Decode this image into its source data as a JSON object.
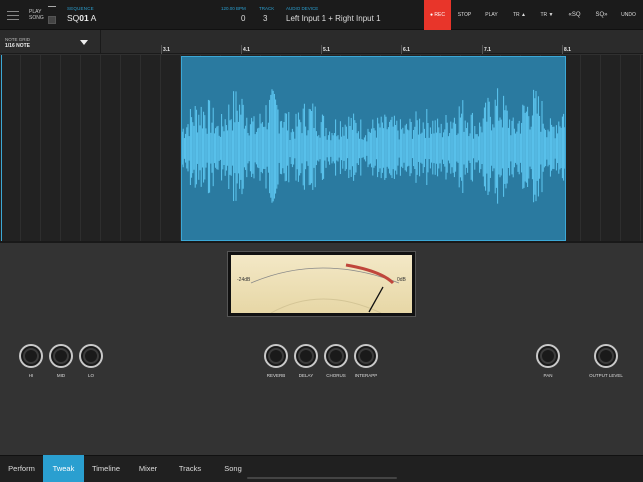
{
  "header": {
    "play_song": "PLAY\nSONG",
    "sequence_label": "SEQUENCE",
    "sequence_prefix": "SQ",
    "sequence_number": "01",
    "sequence_suffix": " A",
    "bpm_label": "120.00 BPM",
    "bpm_value": "0",
    "track_label": "TRACK",
    "track_value": "3",
    "audio_device_label": "AUDIO DEVICE",
    "audio_device_value": "Left Input 1 + Right Input 1",
    "rec_label": "● REC",
    "stop_label": "STOP",
    "play_label": "PLAY",
    "tr_up": "TR ▲",
    "tr_down": "TR ▼",
    "sq_prev": "«SQ",
    "sq_next": "SQ»",
    "undo": "UNDO",
    "rec_color": "#e8352a"
  },
  "note_grid": {
    "label": "NOTE GRID",
    "value": "1/16 NOTE"
  },
  "ruler": [
    "3.1",
    "4.1",
    "5.1",
    "6.1",
    "7.1",
    "8.1"
  ],
  "vu_meter": {
    "min_label": "-24dB",
    "max_label": "0dB"
  },
  "knobs": {
    "hi": "HI",
    "mid": "MID",
    "lo": "LO",
    "reverb": "REVERB",
    "delay": "DELAY",
    "chorus": "CHORUS",
    "interapp": "INTERAPP",
    "pan": "PAN",
    "output_level": "OUTPUT LEVEL"
  },
  "tabs": {
    "perform": "Perform",
    "tweak": "Tweak",
    "timeline": "Timeline",
    "mixer": "Mixer",
    "tracks": "Tracks",
    "song": "Song",
    "active": "Tweak"
  },
  "colors": {
    "accent": "#2a9fd0",
    "waveform": "#5ec8f2",
    "region": "#2a7aa0"
  }
}
